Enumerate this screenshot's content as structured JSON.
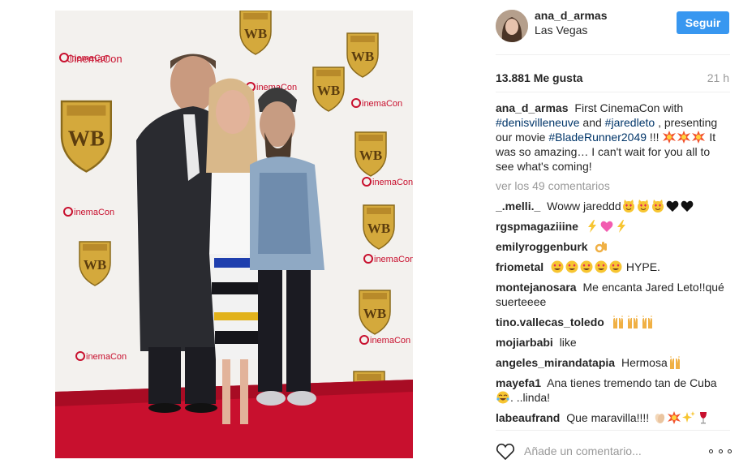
{
  "post": {
    "username": "ana_d_armas",
    "location": "Las Vegas",
    "follow_label": "Seguir",
    "likes": "13.881 Me gusta",
    "time_ago": "21 h",
    "comment_placeholder": "Añade un comentario...",
    "photo_description_icons": [
      "warner-bros-logo",
      "cinemacon-logo"
    ],
    "photo_logo_text": "CinemaCon"
  },
  "caption": {
    "user": "ana_d_armas",
    "t1": "First CinemaCon with",
    "tag1": "#denisvilleneuve",
    "t2": "and",
    "tag2": "#jaredleto",
    "t3": ", presenting our movie",
    "tag3": "#BladeRunner2049",
    "t4": "!!!",
    "t5": "It was so amazing… I can't wait for you all to see what's coming!",
    "emojis": [
      "collision",
      "collision",
      "collision"
    ]
  },
  "view_all": "ver los 49 comentarios",
  "comments": [
    {
      "user": "_.melli._",
      "text": "Woww jareddd",
      "emojis": [
        "heart-eyes-cat",
        "heart-eyes-cat",
        "heart-eyes-cat",
        "black-heart",
        "black-heart"
      ]
    },
    {
      "user": "rgspmagaziiine",
      "text": "",
      "emojis": [
        "lightning",
        "pink-heart",
        "lightning"
      ]
    },
    {
      "user": "emilyroggenburk",
      "text": "",
      "emojis": [
        "ok-hand"
      ]
    },
    {
      "user": "friometal",
      "text": "HYPE.",
      "emojis": [
        "heart-eyes",
        "heart-eyes",
        "heart-eyes",
        "heart-eyes",
        "heart-eyes"
      ]
    },
    {
      "user": "montejanosara",
      "text": "Me encanta Jared Leto!!qué suerteeee",
      "emojis": []
    },
    {
      "user": "tino.vallecas_toledo",
      "text": "",
      "emojis": [
        "raised-hands",
        "raised-hands",
        "raised-hands"
      ]
    },
    {
      "user": "mojiarbabi",
      "text": "like",
      "emojis": []
    },
    {
      "user": "angeles_mirandatapia",
      "text": "Hermosa",
      "emojis": [
        "raised-hands"
      ]
    },
    {
      "user": "mayefa1",
      "text": "Ana tienes tremendo tan de Cuba",
      "text2": ". ..linda!",
      "emojis": [
        "tears-of-joy"
      ]
    },
    {
      "user": "labeaufrand",
      "text": "Que maravilla!!!!",
      "emojis": [
        "clap",
        "collision",
        "sparkles",
        "wine-glass"
      ]
    }
  ],
  "colors": {
    "follow_button": "#3897f0",
    "hashtag": "#003569",
    "muted": "#999999",
    "carpet": "#c8102e"
  }
}
